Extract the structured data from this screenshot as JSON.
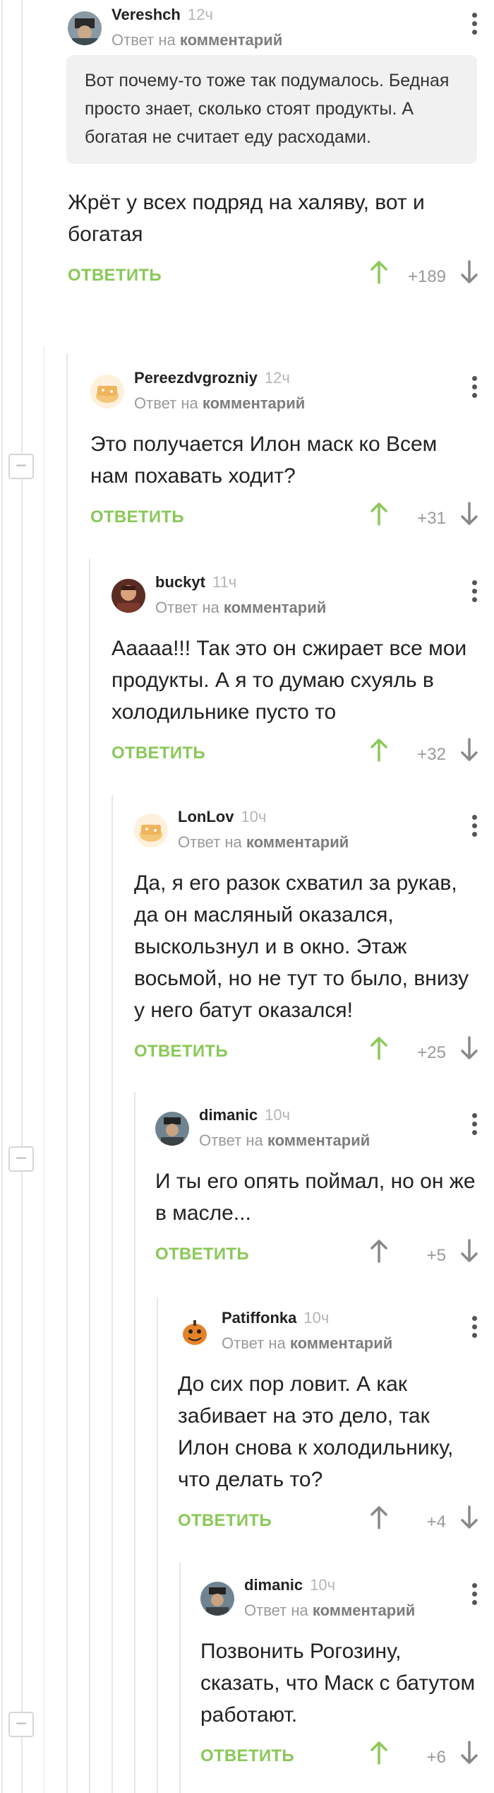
{
  "labels": {
    "reply_to": "Ответ на",
    "comment_word": "комментарий",
    "reply_button": "ОТВЕТИТЬ"
  },
  "colors": {
    "accent_green": "#8ac858",
    "upvote_gray": "#888888",
    "line": "#e6e6e6"
  },
  "comments": [
    {
      "author": "Vereshch",
      "age": "12ч",
      "quote": "Вот почему-то тоже так подумалось. Бедная просто знает, сколько стоят продукты. А богатая не считает еду расходами.",
      "text": "Жрёт у всех подряд на халяву, вот и богатая",
      "votes": "+189",
      "upvoted": true
    },
    {
      "author": "Pereezdvgrozniy",
      "age": "12ч",
      "text": "Это получается Илон маск ко Всем нам похавать ходит?",
      "votes": "+31",
      "upvoted": true
    },
    {
      "author": "buckyt",
      "age": "11ч",
      "text": "Ааааа!!! Так это он сжирает все мои продукты. А я то думаю схуяль в холодильнике пусто то",
      "votes": "+32",
      "upvoted": true
    },
    {
      "author": "LonLov",
      "age": "10ч",
      "text": "Да, я его разок схватил за рукав, да он масляный оказался, выскользнул и в окно. Этаж восьмой, но не тут то было, внизу у него батут оказался!",
      "votes": "+25",
      "upvoted": true
    },
    {
      "author": "dimanic",
      "age": "10ч",
      "text": "И ты его опять поймал, но он же в масле...",
      "votes": "+5",
      "upvoted": false
    },
    {
      "author": "Patiffonka",
      "age": "10ч",
      "text": "До сих пор ловит. А как забивает на это дело, так Илон снова к холодильнику, что делать то?",
      "votes": "+4",
      "upvoted": false
    },
    {
      "author": "dimanic",
      "age": "10ч",
      "text": "Позвонить Рогозину, сказать, что Маск с батутом работают.",
      "votes": "+6",
      "upvoted": true
    }
  ],
  "collapse_symbol": "−"
}
